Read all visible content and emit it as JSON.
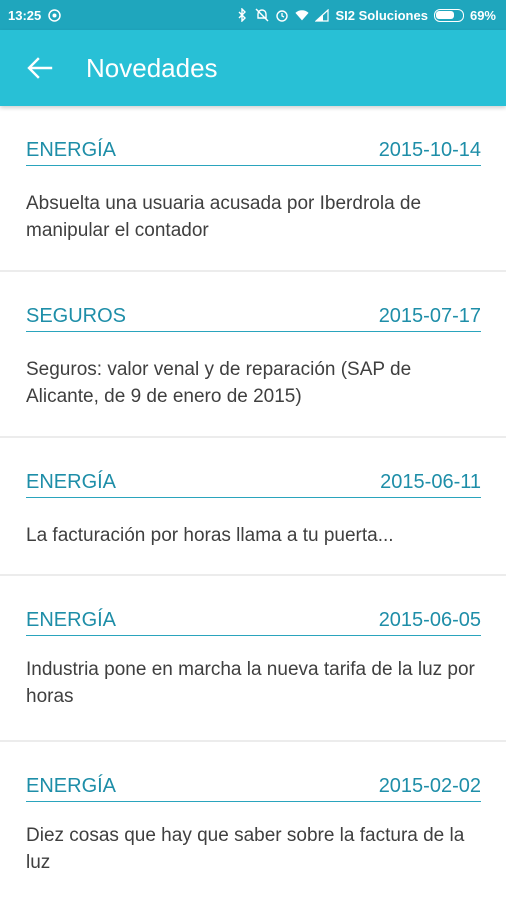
{
  "status_bar": {
    "time": "13:25",
    "carrier": "SI2 Soluciones",
    "battery": "69%",
    "battery_level": 0.69,
    "icons": [
      "notification-icon",
      "bluetooth-icon",
      "do-not-disturb-icon",
      "alarm-icon",
      "wifi-icon",
      "signal-icon"
    ]
  },
  "toolbar": {
    "title": "Novedades",
    "back_icon": "arrow-left-icon"
  },
  "colors": {
    "status_bar": "#1fa6bd",
    "toolbar": "#28c0d6",
    "category": "#1e8ea8",
    "body_text": "#3f3f3f",
    "divider": "#ececec"
  },
  "news": [
    {
      "category": "ENERGÍA",
      "date": "2015-10-14",
      "text": "Absuelta una usuaria acusada por Iberdrola de manipular el contador"
    },
    {
      "category": "SEGUROS",
      "date": "2015-07-17",
      "text": "Seguros: valor venal y de reparación (SAP de Alicante, de 9 de enero de 2015)"
    },
    {
      "category": "ENERGÍA",
      "date": "2015-06-11",
      "text": "La facturación por horas llama a tu puerta..."
    },
    {
      "category": "ENERGÍA",
      "date": "2015-06-05",
      "text": "Industria pone en marcha la nueva tarifa de la luz por horas"
    },
    {
      "category": "ENERGÍA",
      "date": "2015-02-02",
      "text": "Diez cosas que hay que saber sobre la factura de la luz"
    }
  ]
}
